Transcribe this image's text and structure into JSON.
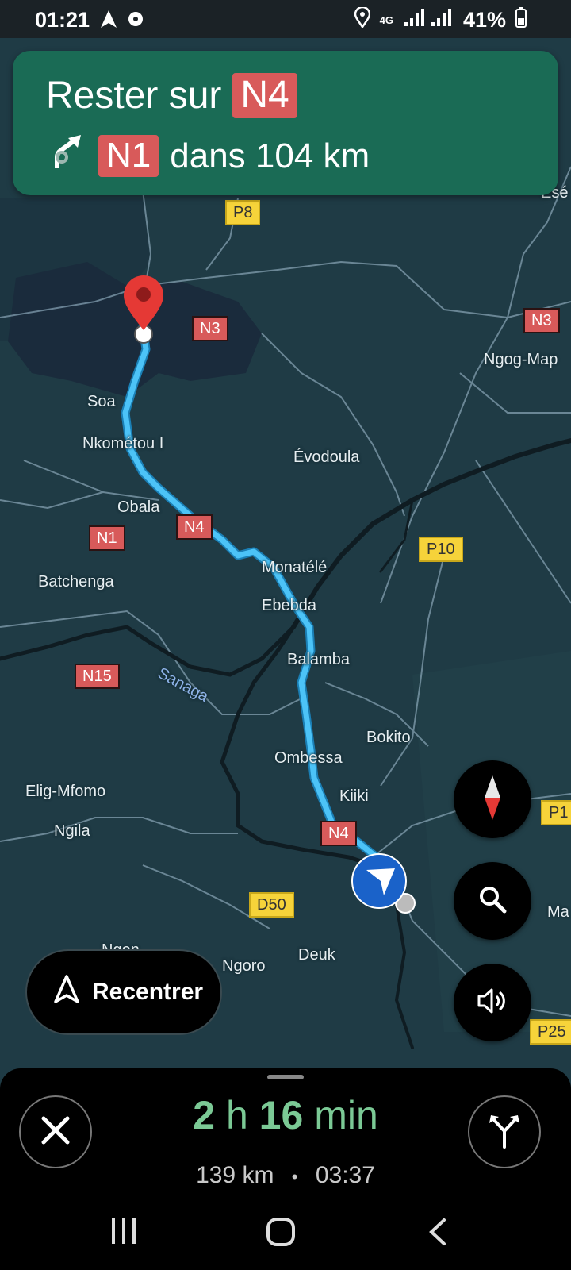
{
  "status_bar": {
    "time": "01:21",
    "network": "4G",
    "battery": "41%"
  },
  "banner": {
    "line1_prefix": "Rester sur",
    "line1_road": "N4",
    "line2_road": "N1",
    "line2_suffix": "dans 104 km",
    "color": "#1a6b55"
  },
  "map": {
    "places": [
      "Soa",
      "Nkométou I",
      "Obala",
      "Batchenga",
      "Évodoula",
      "Monatélé",
      "Ebebda",
      "Balamba",
      "Bokito",
      "Ombessa",
      "Kiiki",
      "Elig-Mfomo",
      "Ngila",
      "Ngoro",
      "Deuk",
      "Ngog-Map",
      "Sanaga",
      "Esé",
      "Ma",
      "Ngon"
    ],
    "red_shields": [
      "N3",
      "N3",
      "N1",
      "N4",
      "N15",
      "N4"
    ],
    "yellow_shields": [
      "P8",
      "P10",
      "D50",
      "P1",
      "P25"
    ],
    "route_color": "#4cc3f7"
  },
  "controls": {
    "recenter_label": "Recentrer",
    "compass_icon": "compass-icon",
    "search_icon": "search-icon",
    "sound_icon": "volume-icon"
  },
  "trip": {
    "hours": "2",
    "hours_unit": "h",
    "minutes": "16",
    "minutes_unit": "min",
    "distance": "139 km",
    "separator": "•",
    "arrival": "03:37"
  }
}
